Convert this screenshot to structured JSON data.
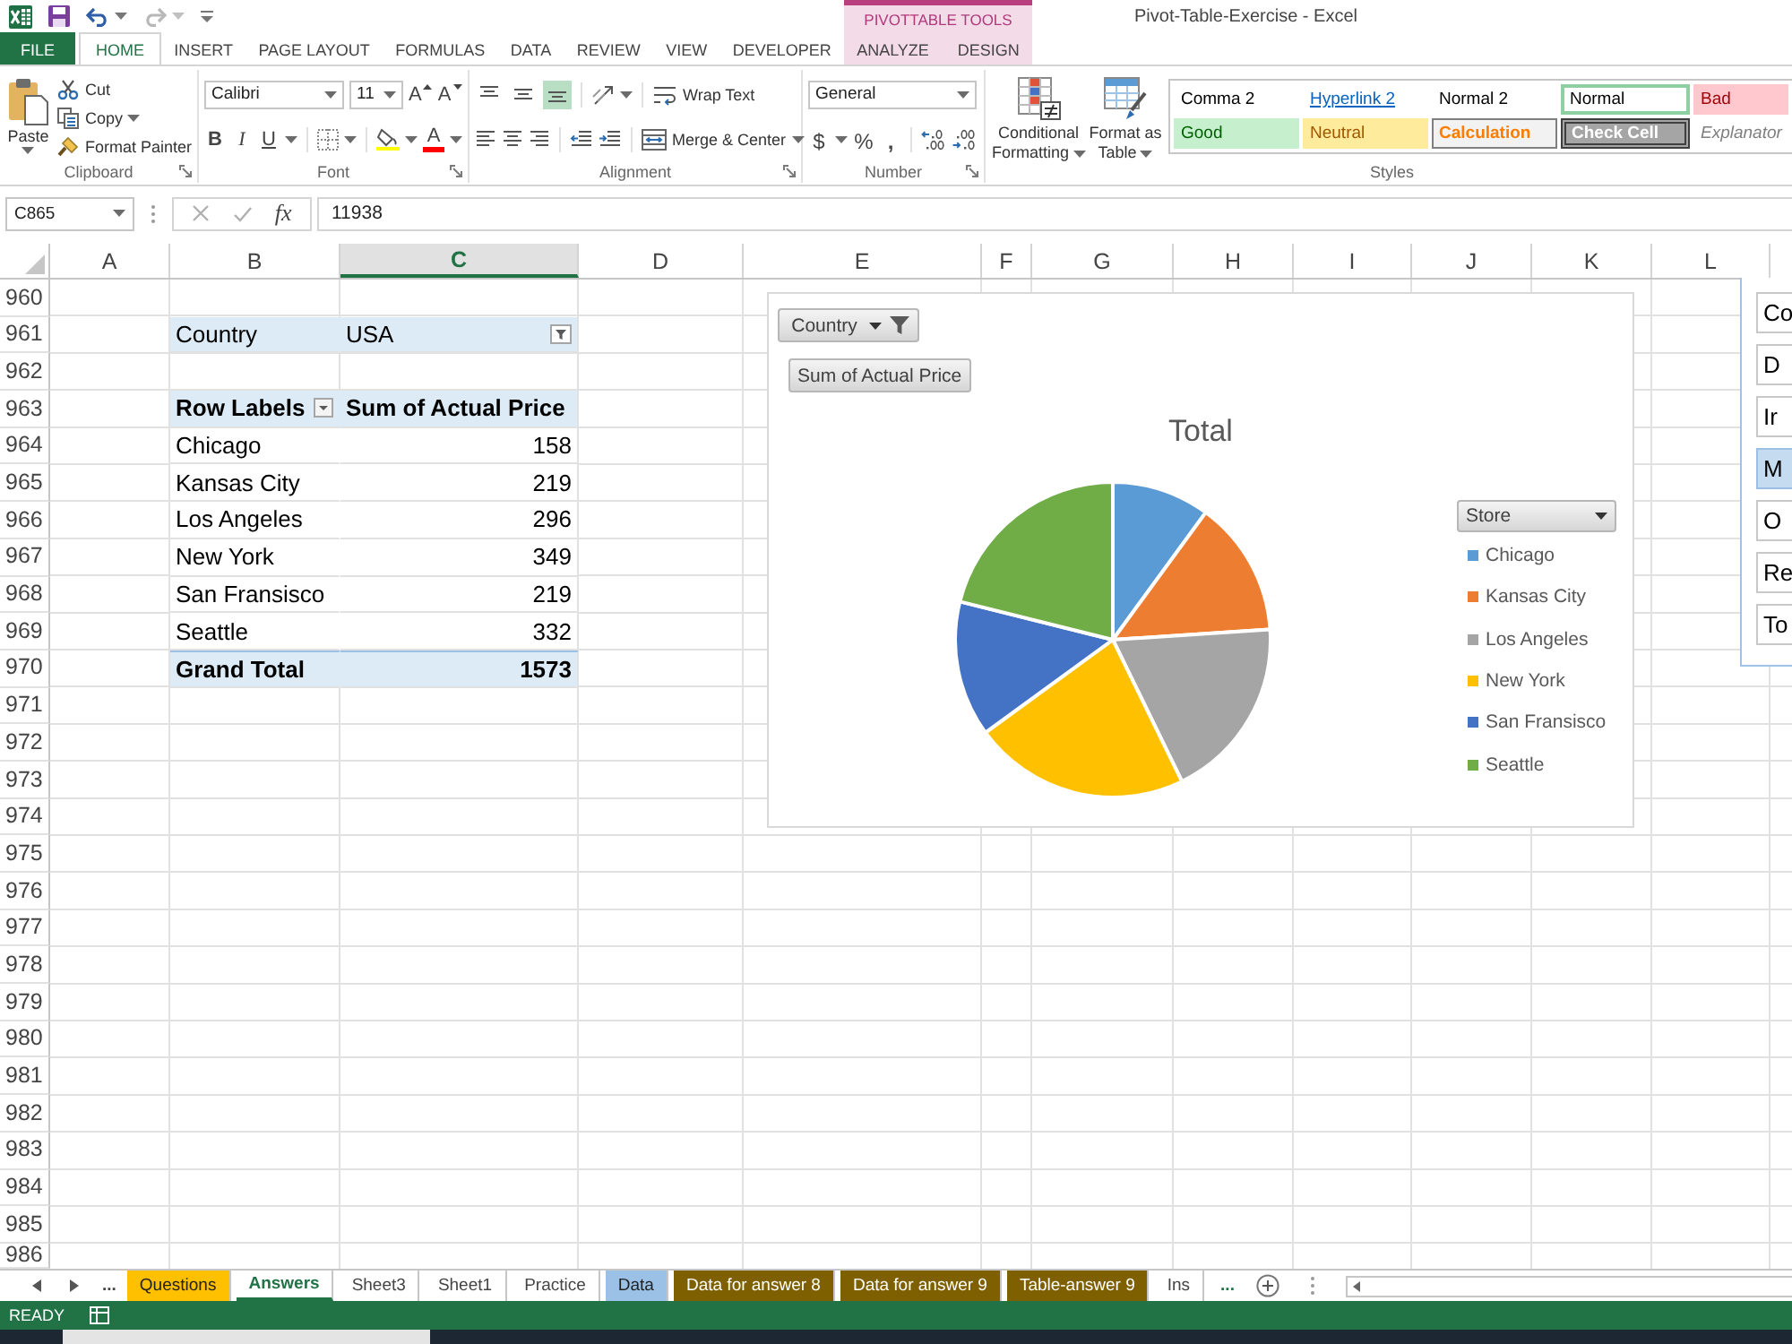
{
  "window": {
    "title": "Pivot-Table-Exercise - Excel"
  },
  "quick_access_toolbar": [
    {
      "kind": "save",
      "disabled": false
    },
    {
      "kind": "undo",
      "disabled": false
    },
    {
      "kind": "redo",
      "disabled": true
    },
    {
      "kind": "customize",
      "disabled": false
    }
  ],
  "ribbon_tabs": [
    {
      "label": "FILE",
      "kind": "file",
      "selected": false
    },
    {
      "label": "HOME",
      "kind": "tab",
      "selected": true
    },
    {
      "label": "INSERT",
      "kind": "tab",
      "selected": false
    },
    {
      "label": "PAGE LAYOUT",
      "kind": "tab",
      "selected": false
    },
    {
      "label": "FORMULAS",
      "kind": "tab",
      "selected": false
    },
    {
      "label": "DATA",
      "kind": "tab",
      "selected": false
    },
    {
      "label": "REVIEW",
      "kind": "tab",
      "selected": false
    },
    {
      "label": "VIEW",
      "kind": "tab",
      "selected": false
    },
    {
      "label": "DEVELOPER",
      "kind": "tab",
      "selected": false
    }
  ],
  "contextual_tabs": {
    "title": "PIVOTTABLE TOOLS",
    "tabs": [
      {
        "label": "ANALYZE",
        "selected": false
      },
      {
        "label": "DESIGN",
        "selected": false
      }
    ]
  },
  "ribbon": {
    "clipboard": {
      "label": "Clipboard",
      "paste": "Paste",
      "cut": "Cut",
      "copy": "Copy",
      "format_painter": "Format Painter"
    },
    "font": {
      "label": "Font",
      "font_name": "Calibri",
      "font_size": "11",
      "grow_font": "A",
      "shrink_font": "A",
      "bold": "B",
      "italic": "I",
      "underline": "U",
      "font_color": "A"
    },
    "alignment": {
      "label": "Alignment",
      "vertical_align": [
        {
          "kind": "top",
          "selected": false
        },
        {
          "kind": "middle",
          "selected": false
        },
        {
          "kind": "bottom",
          "selected": true
        }
      ],
      "horizontal_align": [
        {
          "kind": "left",
          "selected": false
        },
        {
          "kind": "center",
          "selected": false
        },
        {
          "kind": "right",
          "selected": false
        }
      ],
      "wrap_text": "Wrap Text",
      "merge_center": "Merge & Center"
    },
    "number": {
      "label": "Number",
      "format": "General",
      "currency": "$",
      "percent": "%",
      "comma": ","
    },
    "styles": {
      "label": "Styles",
      "conditional_formatting": "Conditional Formatting",
      "format_as_table": "Format as Table",
      "gallery": [
        {
          "label": "Comma 2",
          "kind": "plain",
          "selected": false
        },
        {
          "label": "Hyperlink 2",
          "kind": "link",
          "selected": false
        },
        {
          "label": "Normal 2",
          "kind": "plain",
          "selected": false
        },
        {
          "label": "Normal",
          "kind": "plain",
          "selected": true
        },
        {
          "label": "Bad",
          "kind": "bad",
          "selected": false
        },
        {
          "label": "Good",
          "kind": "good",
          "selected": false
        },
        {
          "label": "Neutral",
          "kind": "neutral",
          "selected": false
        },
        {
          "label": "Calculation",
          "kind": "calculation",
          "selected": false
        },
        {
          "label": "Check Cell",
          "kind": "check",
          "selected": false
        },
        {
          "label": "Explanator",
          "kind": "explanatory",
          "selected": false
        }
      ]
    }
  },
  "formula_bar": {
    "name_box": "C865",
    "edit_buttons": [
      {
        "kind": "cancel",
        "disabled": true
      },
      {
        "kind": "enter",
        "disabled": true
      }
    ],
    "insert_function": "fx",
    "value": "11938"
  },
  "columns": [
    {
      "label": "A",
      "selected": false
    },
    {
      "label": "B",
      "selected": false
    },
    {
      "label": "C",
      "selected": true
    },
    {
      "label": "D",
      "selected": false
    },
    {
      "label": "E",
      "selected": false
    },
    {
      "label": "F",
      "selected": false
    },
    {
      "label": "G",
      "selected": false
    },
    {
      "label": "H",
      "selected": false
    },
    {
      "label": "I",
      "selected": false
    },
    {
      "label": "J",
      "selected": false
    },
    {
      "label": "K",
      "selected": false
    },
    {
      "label": "L",
      "selected": false
    }
  ],
  "row_numbers": [
    "960",
    "961",
    "962",
    "963",
    "964",
    "965",
    "966",
    "967",
    "968",
    "969",
    "970",
    "971",
    "972",
    "973",
    "974",
    "975",
    "976",
    "977",
    "978",
    "979",
    "980",
    "981",
    "982",
    "983",
    "984",
    "985",
    "986"
  ],
  "pivot_table": {
    "filter": {
      "label": "Country",
      "value": "USA"
    },
    "header": {
      "row_labels": "Row Labels",
      "values": "Sum of Actual Price"
    },
    "rows": [
      {
        "label": "Chicago",
        "value": "158"
      },
      {
        "label": "Kansas City",
        "value": "219"
      },
      {
        "label": "Los Angeles",
        "value": "296"
      },
      {
        "label": "New York",
        "value": "349"
      },
      {
        "label": "San Fransisco",
        "value": "219"
      },
      {
        "label": "Seattle",
        "value": "332"
      }
    ],
    "grand_total": {
      "label": "Grand Total",
      "value": "1573"
    }
  },
  "pivot_chart": {
    "country_button": "Country",
    "value_button": "Sum of Actual Price",
    "chart_data": [
      {
        "type": "pie",
        "title": "Total",
        "legend_title": "Store",
        "legend": "right",
        "categories": [
          "Chicago",
          "Kansas City",
          "Los Angeles",
          "New York",
          "San Fransisco",
          "Seattle"
        ],
        "values": [
          10.04,
          13.92,
          18.82,
          22.19,
          13.92,
          21.11
        ],
        "colors": [
          "#5b9bd5",
          "#ed7d31",
          "#a5a5a5",
          "#ffc000",
          "#4472c4",
          "#70ad47"
        ]
      }
    ]
  },
  "slicer": {
    "items": [
      {
        "label": "Co",
        "selected": false
      },
      {
        "label": "D",
        "selected": false
      },
      {
        "label": "Ir",
        "selected": false
      },
      {
        "label": "M",
        "selected": true
      },
      {
        "label": "O",
        "selected": false
      },
      {
        "label": "Re",
        "selected": false
      },
      {
        "label": "To",
        "selected": false
      }
    ]
  },
  "sheet_tabs": {
    "more_left": "...",
    "tabs": [
      {
        "label": "Questions",
        "selected": false,
        "color": "#ffc000"
      },
      {
        "label": "Answers",
        "selected": true
      },
      {
        "label": "Sheet3",
        "selected": false
      },
      {
        "label": "Sheet1",
        "selected": false
      },
      {
        "label": "Practice",
        "selected": false
      },
      {
        "label": "Data",
        "selected": false,
        "color": "#9bc2e6"
      },
      {
        "label": "Data for answer 8",
        "selected": false,
        "color": "#7f6000"
      },
      {
        "label": "Data for answer 9",
        "selected": false,
        "color": "#7f6000"
      },
      {
        "label": "Table-answer 9",
        "selected": false,
        "color": "#7f6000"
      },
      {
        "label": "Ins",
        "selected": false
      }
    ],
    "more_right": "..."
  },
  "status_bar": {
    "mode": "READY"
  }
}
